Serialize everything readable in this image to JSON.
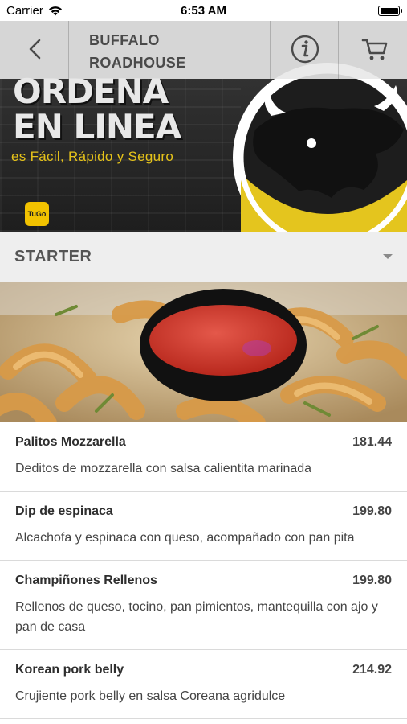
{
  "status_bar": {
    "carrier": "Carrier",
    "time": "6:53 AM"
  },
  "nav": {
    "title_line1": "BUFFALO",
    "title_line2": "ROADHOUSE",
    "icons": [
      "back-chevron-icon",
      "info-icon",
      "cart-icon"
    ]
  },
  "banner": {
    "title_line1": "ORDENA",
    "title_line2": "EN LINEA",
    "subtitle": "es Fácil, Rápido y Seguro",
    "badge": "TuGo",
    "accent_color": "#e5c21a"
  },
  "category": {
    "label": "STARTER"
  },
  "menu": {
    "items": [
      {
        "name": "Palitos Mozzarella",
        "price": "181.44",
        "description": "Deditos de mozzarella con salsa calientita marinada"
      },
      {
        "name": "Dip de espinaca",
        "price": "199.80",
        "description": "Alcachofa y espinaca con queso, acompañado con pan pita"
      },
      {
        "name": "Champiñones Rellenos",
        "price": "199.80",
        "description": "Rellenos de queso, tocino, pan pimientos, mantequilla con ajo y pan de casa"
      },
      {
        "name": "Korean pork belly",
        "price": "214.92",
        "description": "Crujiente pork belly en salsa Coreana agridulce"
      }
    ]
  }
}
